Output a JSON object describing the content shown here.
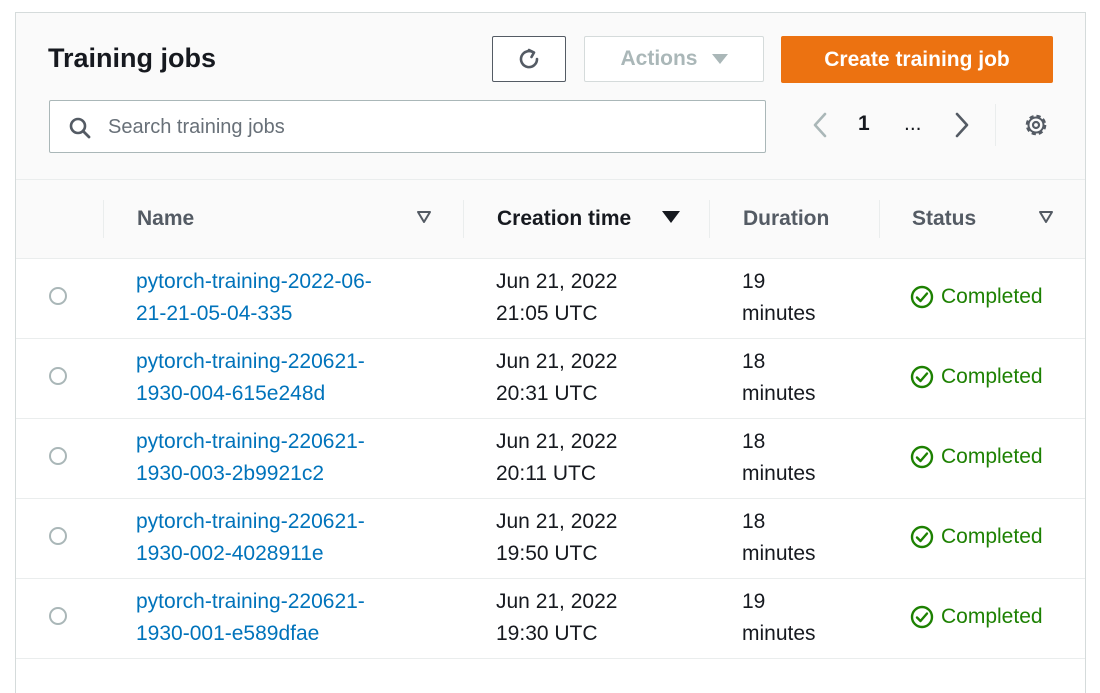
{
  "title": "Training jobs",
  "toolbar": {
    "refresh_icon": "refresh-icon",
    "actions_label": "Actions",
    "create_label": "Create training job"
  },
  "search": {
    "placeholder": "Search training jobs",
    "icon": "search-icon"
  },
  "pagination": {
    "current_page": "1",
    "ellipsis": "..."
  },
  "columns": {
    "name": "Name",
    "creation_time": "Creation time",
    "duration": "Duration",
    "status": "Status"
  },
  "rows": [
    {
      "name_line1": "pytorch-training-2022-06-",
      "name_line2": "21-21-05-04-335",
      "date": "Jun 21, 2022",
      "time": "21:05 UTC",
      "duration_value": "19",
      "duration_unit": "minutes",
      "status": "Completed"
    },
    {
      "name_line1": "pytorch-training-220621-",
      "name_line2": "1930-004-615e248d",
      "date": "Jun 21, 2022",
      "time": "20:31 UTC",
      "duration_value": "18",
      "duration_unit": "minutes",
      "status": "Completed"
    },
    {
      "name_line1": "pytorch-training-220621-",
      "name_line2": "1930-003-2b9921c2",
      "date": "Jun 21, 2022",
      "time": "20:11 UTC",
      "duration_value": "18",
      "duration_unit": "minutes",
      "status": "Completed"
    },
    {
      "name_line1": "pytorch-training-220621-",
      "name_line2": "1930-002-4028911e",
      "date": "Jun 21, 2022",
      "time": "19:50 UTC",
      "duration_value": "18",
      "duration_unit": "minutes",
      "status": "Completed"
    },
    {
      "name_line1": "pytorch-training-220621-",
      "name_line2": "1930-001-e589dfae",
      "date": "Jun 21, 2022",
      "time": "19:30 UTC",
      "duration_value": "19",
      "duration_unit": "minutes",
      "status": "Completed"
    }
  ],
  "colors": {
    "primary": "#ec7211",
    "link": "#0073bb",
    "success": "#1d8102",
    "border": "#eaeded"
  }
}
